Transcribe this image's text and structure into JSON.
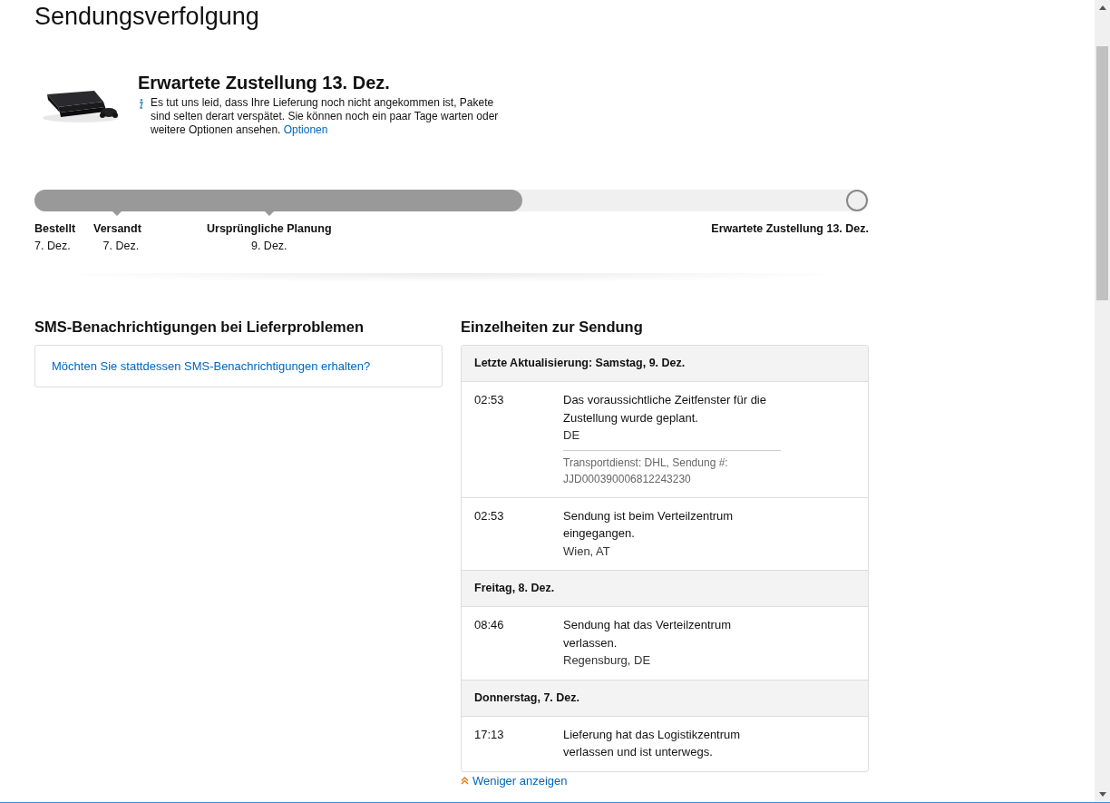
{
  "page_title": "Sendungsverfolgung",
  "delivery": {
    "heading": "Erwartete Zustellung 13. Dez.",
    "message": "Es tut uns leid, dass Ihre Lieferung noch nicht angekommen ist, Pakete sind selten derart verspätet. Sie können noch ein paar Tage warten oder weitere Optionen ansehen.",
    "link": "Optionen"
  },
  "progress": {
    "level": 0.585,
    "milestones": [
      {
        "label": "Bestellt",
        "date": "7. Dez.",
        "pointer": false
      },
      {
        "label": "Versandt",
        "date": "7. Dez.",
        "pointer": true
      },
      {
        "label": "Ursprüngliche Planung",
        "date": "9. Dez.",
        "pointer": true
      },
      {
        "label": "Erwartete Zustellung 13. Dez.",
        "pointer": false
      }
    ]
  },
  "sms": {
    "heading": "SMS-Benachrichtigungen bei Lieferproblemen",
    "link": "Möchten Sie stattdessen SMS-Benachrichtigungen erhalten?"
  },
  "details": {
    "heading": "Einzelheiten zur Sendung",
    "groups": [
      {
        "date": "Letzte Aktualisierung: Samstag, 9. Dez.",
        "events": [
          {
            "time": "02:53",
            "text": "Das voraussichtliche Zeitfenster für die Zustellung wurde geplant.",
            "location": "DE",
            "carrier": "Transportdienst: DHL, Sendung #: JJD000390006812243230"
          },
          {
            "time": "02:53",
            "text": "Sendung ist beim Verteilzentrum eingegangen.",
            "location": "Wien, AT"
          }
        ]
      },
      {
        "date": "Freitag, 8. Dez.",
        "events": [
          {
            "time": "08:46",
            "text": "Sendung hat das Verteilzentrum verlassen.",
            "location": "Regensburg, DE"
          }
        ]
      },
      {
        "date": "Donnerstag, 7. Dez.",
        "events": [
          {
            "time": "17:13",
            "text": "Lieferung hat das Logistikzentrum verlassen und ist unterwegs."
          }
        ]
      }
    ],
    "toggle": "Weniger anzeigen"
  }
}
